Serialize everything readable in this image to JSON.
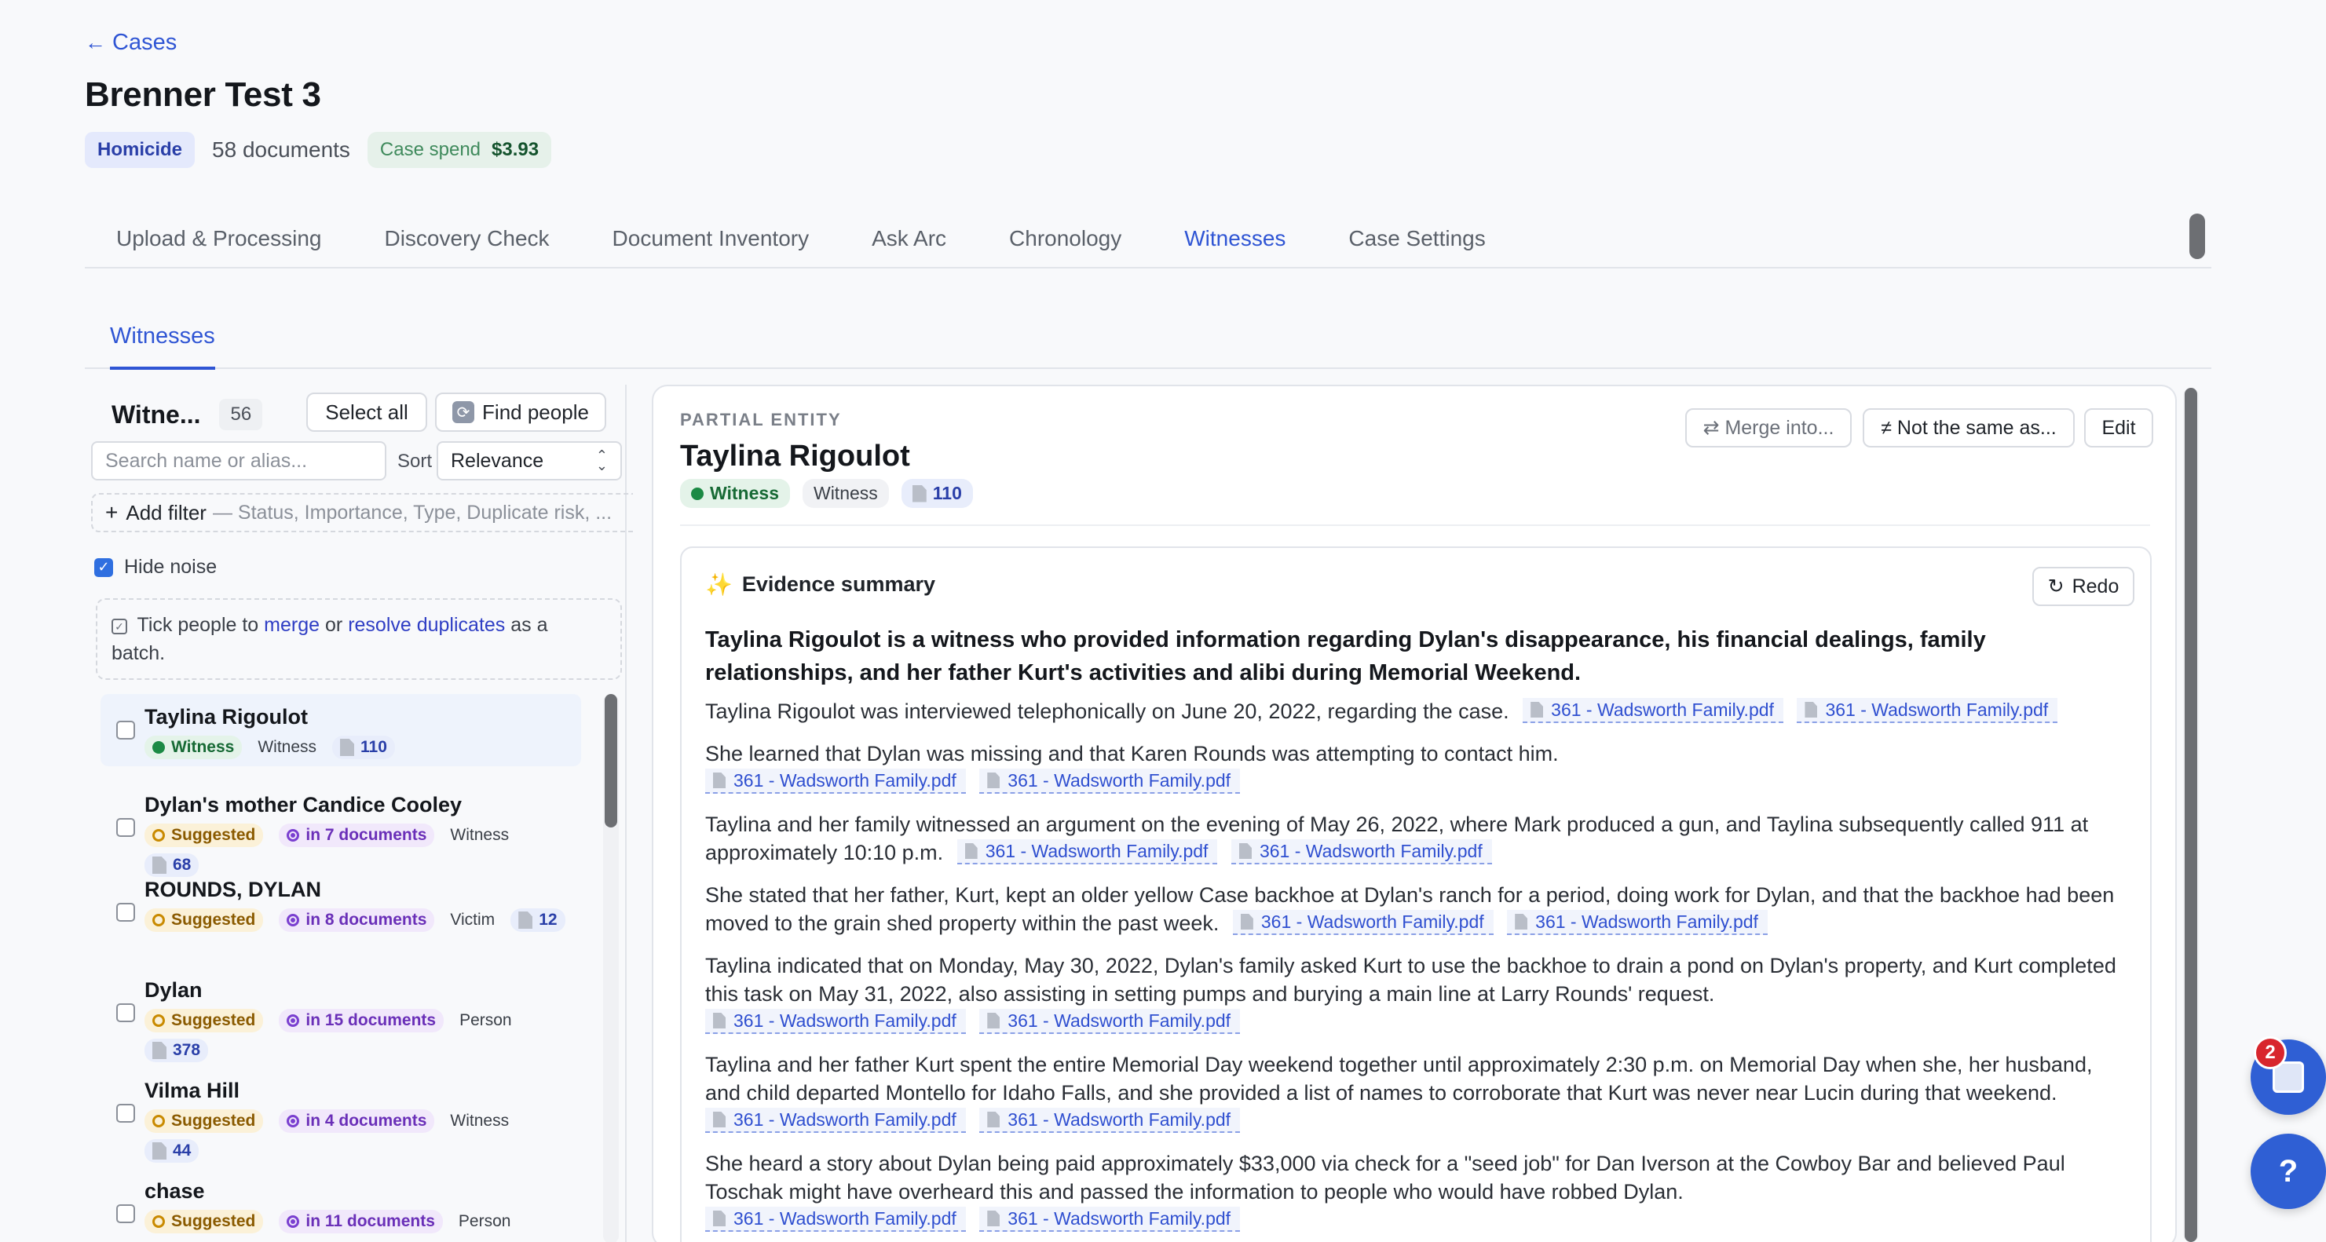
{
  "header": {
    "back_label": "Cases",
    "case_title": "Brenner Test 3",
    "case_type": "Homicide",
    "document_count": "58 documents",
    "spend_label": "Case spend",
    "spend_value": "$3.93"
  },
  "main_tabs": [
    {
      "label": "Upload & Processing"
    },
    {
      "label": "Discovery Check"
    },
    {
      "label": "Document Inventory"
    },
    {
      "label": "Ask Arc"
    },
    {
      "label": "Chronology"
    },
    {
      "label": "Witnesses",
      "active": true
    },
    {
      "label": "Case Settings"
    }
  ],
  "sub_tab": "Witnesses",
  "left": {
    "title": "Witne...",
    "count": "56",
    "select_all": "Select all",
    "find_people": "Find people",
    "search_placeholder": "Search name or alias...",
    "sort_label": "Sort",
    "sort_value": "Relevance",
    "add_filter": "Add filter",
    "filter_hint": "— Status, Importance, Type, Duplicate risk, ...",
    "hide_noise": "Hide noise",
    "tip": {
      "prefix": "Tick people to",
      "merge": "merge",
      "or": "or",
      "resolve": "resolve duplicates",
      "suffix": "as a batch."
    },
    "people": [
      {
        "name": "Taylina Rigoulot",
        "status": "Witness",
        "type": "Witness",
        "count": "110"
      },
      {
        "name": "Dylan's mother Candice Cooley",
        "status": "Suggested",
        "docs": "in 7 documents",
        "type": "Witness",
        "count": "68"
      },
      {
        "name": "ROUNDS, DYLAN",
        "status": "Suggested",
        "docs": "in 8 documents",
        "type": "Victim",
        "count": "12"
      },
      {
        "name": "Dylan",
        "status": "Suggested",
        "docs": "in 15 documents",
        "type": "Person",
        "count": "378"
      },
      {
        "name": "Vilma Hill",
        "status": "Suggested",
        "docs": "in 4 documents",
        "type": "Witness",
        "count": "44"
      },
      {
        "name": "chase",
        "status": "Suggested",
        "docs": "in 11 documents",
        "type": "Person",
        "count": ""
      }
    ]
  },
  "entity": {
    "kind": "PARTIAL ENTITY",
    "name": "Taylina Rigoulot",
    "status": "Witness",
    "type": "Witness",
    "count": "110",
    "merge_button": "⇄ Merge into...",
    "not_same_button": "≠ Not the same as...",
    "edit_button": "Edit"
  },
  "summary": {
    "title": "Evidence summary",
    "redo": "Redo",
    "lead": "Taylina Rigoulot is a witness who provided information regarding Dylan's disappearance, his financial dealings, family relationships, and her father Kurt's activities and alibi during Memorial Weekend.",
    "citation": "361 - Wadsworth Family.pdf",
    "paragraphs": [
      "Taylina Rigoulot was interviewed telephonically on June 20, 2022, regarding the case.",
      "She learned that Dylan was missing and that Karen Rounds was attempting to contact him.",
      "Taylina and her family witnessed an argument on the evening of May 26, 2022, where Mark produced a gun, and Taylina subsequently called 911 at approximately 10:10 p.m.",
      "She stated that her father, Kurt, kept an older yellow Case backhoe at Dylan's ranch for a period, doing work for Dylan, and that the backhoe had been moved to the grain shed property within the past week.",
      "Taylina indicated that on Monday, May 30, 2022, Dylan's family asked Kurt to use the backhoe to drain a pond on Dylan's property, and Kurt completed this task on May 31, 2022, also assisting in setting pumps and burying a main line at Larry Rounds' request.",
      "Taylina and her father Kurt spent the entire Memorial Day weekend together until approximately 2:30 p.m. on Memorial Day when she, her husband, and child departed Montello for Idaho Falls, and she provided a list of names to corroborate that Kurt was never near Lucin during that weekend.",
      "She heard a story about Dylan being paid approximately $33,000 via check for a \"seed job\" for Dan Iverson at the Cowboy Bar and believed Paul Toschak might have overheard this and passed the information to people who would have robbed Dylan."
    ]
  },
  "fab": {
    "badge": "2",
    "help": "?"
  }
}
